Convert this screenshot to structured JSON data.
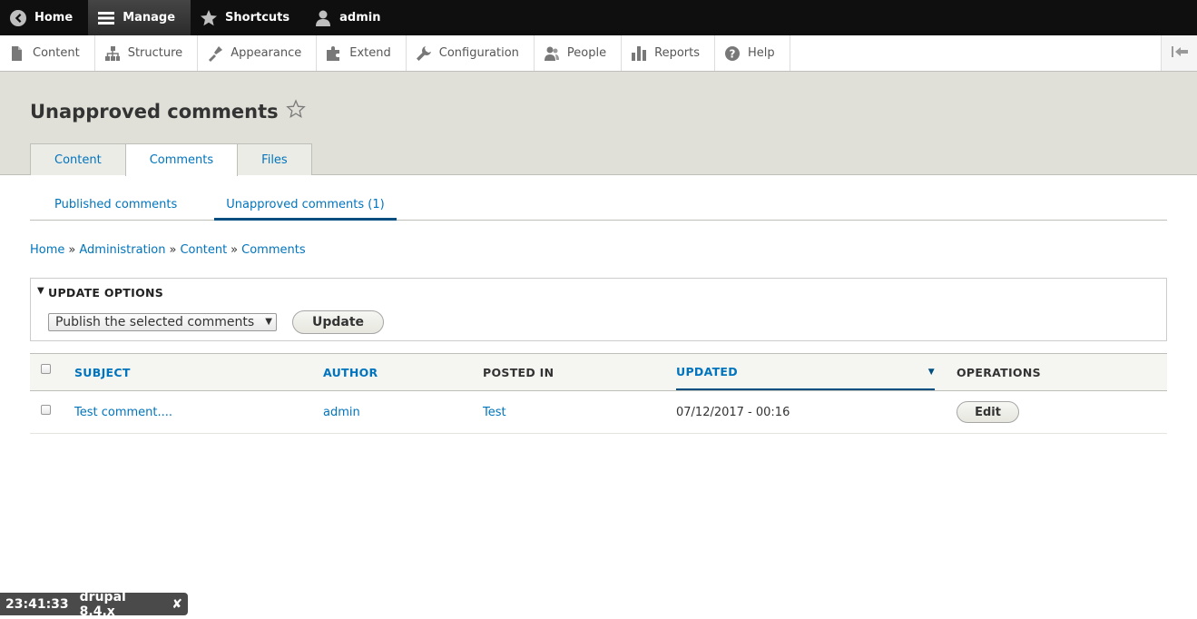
{
  "toolbar": {
    "home": "Home",
    "manage": "Manage",
    "shortcuts": "Shortcuts",
    "user": "admin"
  },
  "tray": {
    "items": [
      {
        "label": "Content",
        "icon": "file-icon"
      },
      {
        "label": "Structure",
        "icon": "sitemap-icon"
      },
      {
        "label": "Appearance",
        "icon": "brush-icon"
      },
      {
        "label": "Extend",
        "icon": "puzzle-icon"
      },
      {
        "label": "Configuration",
        "icon": "wrench-icon"
      },
      {
        "label": "People",
        "icon": "people-icon"
      },
      {
        "label": "Reports",
        "icon": "bar-chart-icon"
      },
      {
        "label": "Help",
        "icon": "help-icon"
      }
    ]
  },
  "page": {
    "title": "Unapproved comments",
    "tabs": [
      "Content",
      "Comments",
      "Files"
    ],
    "active_tab": "Comments",
    "subtabs": [
      "Published comments",
      "Unapproved comments (1)"
    ],
    "active_subtab": "Unapproved comments (1)"
  },
  "breadcrumb": [
    "Home",
    "Administration",
    "Content",
    "Comments"
  ],
  "breadcrumb_sep": "»",
  "update_options": {
    "legend": "UPDATE OPTIONS",
    "selected": "Publish the selected comments",
    "button": "Update"
  },
  "table": {
    "headers": {
      "subject": "SUBJECT",
      "author": "AUTHOR",
      "posted_in": "POSTED IN",
      "updated": "UPDATED",
      "operations": "OPERATIONS"
    },
    "rows": [
      {
        "subject": "Test comment....",
        "author": "admin",
        "posted_in": "Test",
        "updated": "07/12/2017 - 00:16",
        "operation": "Edit"
      }
    ]
  },
  "footer_badge": {
    "time": "23:41:33",
    "label": "drupal 8.4.x",
    "close": "✘"
  },
  "colors": {
    "link": "#0074bd",
    "header_bg": "#e0e0d8",
    "toolbar_bg": "#0f0f0f"
  }
}
